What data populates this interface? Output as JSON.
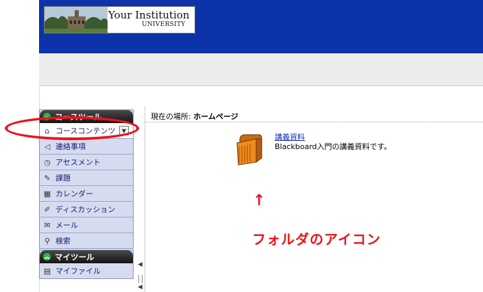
{
  "header": {
    "institution_name": "Your Institution",
    "institution_sub": "UNIVERSITY"
  },
  "course_tools": {
    "title": "コースツール",
    "items": [
      {
        "label": "コースコンテンツ",
        "icon": "home-icon",
        "active": true
      },
      {
        "label": "連絡事項",
        "icon": "megaphone-icon"
      },
      {
        "label": "アセスメント",
        "icon": "assessment-icon"
      },
      {
        "label": "課題",
        "icon": "assignment-icon"
      },
      {
        "label": "カレンダー",
        "icon": "calendar-icon"
      },
      {
        "label": "ディスカッション",
        "icon": "pushpin-icon"
      },
      {
        "label": "メール",
        "icon": "mail-icon"
      },
      {
        "label": "検索",
        "icon": "search-icon"
      }
    ]
  },
  "my_tools": {
    "title": "マイツール",
    "items": [
      {
        "label": "マイファイル",
        "icon": "file-cabinet-icon"
      }
    ]
  },
  "breadcrumb": {
    "prefix": "現在の場所: ",
    "current": "ホームページ"
  },
  "content": {
    "folder_title": "講義資料",
    "folder_description": "Blackboard入門の講義資料です。",
    "folder_icon": "folder-icon"
  },
  "annotation": {
    "arrow": "↑",
    "caption": "フォルダのアイコン",
    "color": "#e8141b"
  },
  "colors": {
    "header_blue": "#0c34a8",
    "panel_bg": "#d6dcf0"
  }
}
